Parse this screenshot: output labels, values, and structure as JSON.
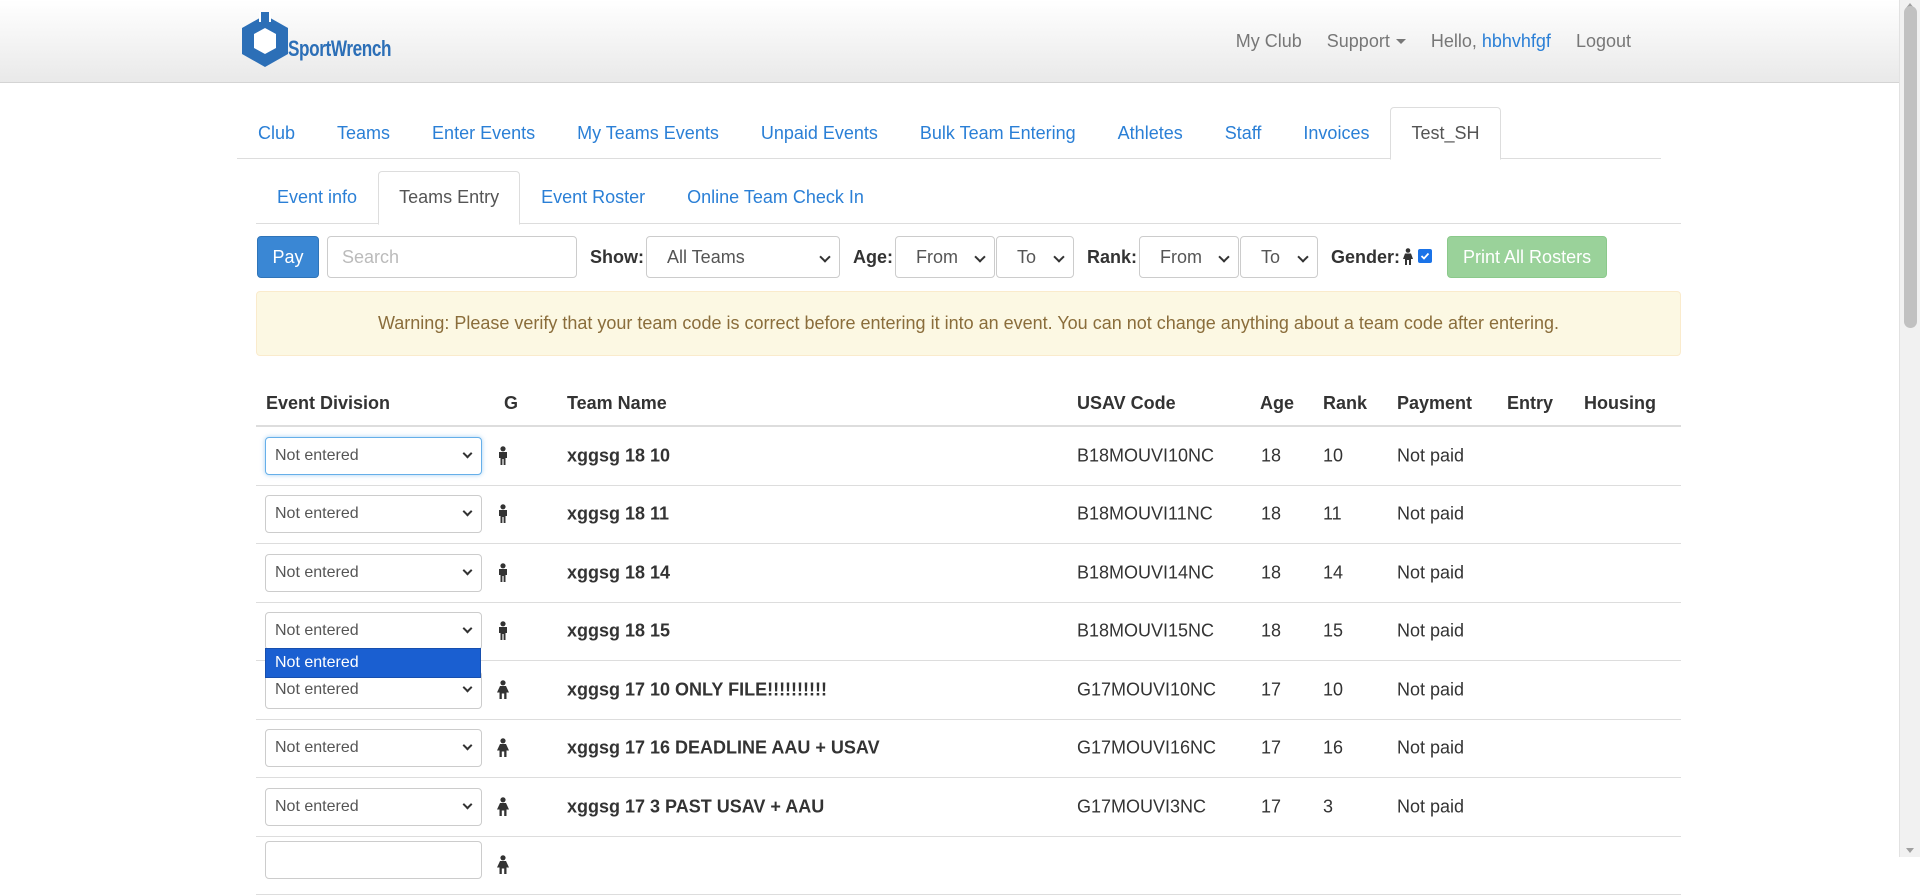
{
  "brand": {
    "name": "SportWrench"
  },
  "navbar": {
    "my_club": "My Club",
    "support": "Support",
    "hello": "Hello,",
    "username": "hbhvhfgf",
    "logout": "Logout"
  },
  "main_tabs": [
    "Club",
    "Teams",
    "Enter Events",
    "My Teams Events",
    "Unpaid Events",
    "Bulk Team Entering",
    "Athletes",
    "Staff",
    "Invoices",
    "Test_SH"
  ],
  "main_tabs_active": "Test_SH",
  "sub_tabs": [
    "Event info",
    "Teams Entry",
    "Event Roster",
    "Online Team Check In"
  ],
  "sub_tabs_active": "Teams Entry",
  "toolbar": {
    "pay_label": "Pay",
    "search_placeholder": "Search",
    "show_label": "Show:",
    "show_value": "All Teams",
    "age_label": "Age:",
    "age_from": "From",
    "age_to": "To",
    "rank_label": "Rank:",
    "rank_from": "From",
    "rank_to": "To",
    "gender_label": "Gender:",
    "gender_checked": true,
    "print_label": "Print All Rosters"
  },
  "warning": "Warning: Please verify that your team code is correct before entering it into an event. You can not change anything about a team code after entering.",
  "table": {
    "headers": {
      "division": "Event Division",
      "g": "G",
      "team": "Team Name",
      "usav": "USAV Code",
      "age": "Age",
      "rank": "Rank",
      "payment": "Payment",
      "entry": "Entry",
      "housing": "Housing"
    },
    "rows": [
      {
        "division": "Not entered",
        "gender": "male",
        "team": "xggsg 18 10",
        "usav": "B18MOUVI10NC",
        "age": "18",
        "rank": "10",
        "payment": "Not paid"
      },
      {
        "division": "Not entered",
        "gender": "male",
        "team": "xggsg 18 11",
        "usav": "B18MOUVI11NC",
        "age": "18",
        "rank": "11",
        "payment": "Not paid"
      },
      {
        "division": "Not entered",
        "gender": "male",
        "team": "xggsg 18 14",
        "usav": "B18MOUVI14NC",
        "age": "18",
        "rank": "14",
        "payment": "Not paid"
      },
      {
        "division": "Not entered",
        "gender": "male",
        "team": "xggsg 18 15",
        "usav": "B18MOUVI15NC",
        "age": "18",
        "rank": "15",
        "payment": "Not paid"
      },
      {
        "division": "Not entered",
        "gender": "female",
        "team": "xggsg 17 10 ONLY FILE!!!!!!!!!!",
        "usav": "G17MOUVI10NC",
        "age": "17",
        "rank": "10",
        "payment": "Not paid"
      },
      {
        "division": "Not entered",
        "gender": "female",
        "team": "xggsg 17 16 DEADLINE AAU + USAV",
        "usav": "G17MOUVI16NC",
        "age": "17",
        "rank": "16",
        "payment": "Not paid"
      },
      {
        "division": "Not entered",
        "gender": "female",
        "team": "xggsg 17 3 PAST USAV + AAU",
        "usav": "G17MOUVI3NC",
        "age": "17",
        "rank": "3",
        "payment": "Not paid"
      },
      {
        "division": "",
        "gender": "female",
        "team": "",
        "usav": "",
        "age": "",
        "rank": "",
        "payment": ""
      }
    ]
  },
  "open_dropdown": {
    "option": "Not entered"
  },
  "colors": {
    "link": "#2a7fd6",
    "pay_button": "#3a87d4",
    "print_button": "#9ad29a",
    "warning_bg": "#fcf8e3",
    "warning_text": "#8a6d3b"
  }
}
